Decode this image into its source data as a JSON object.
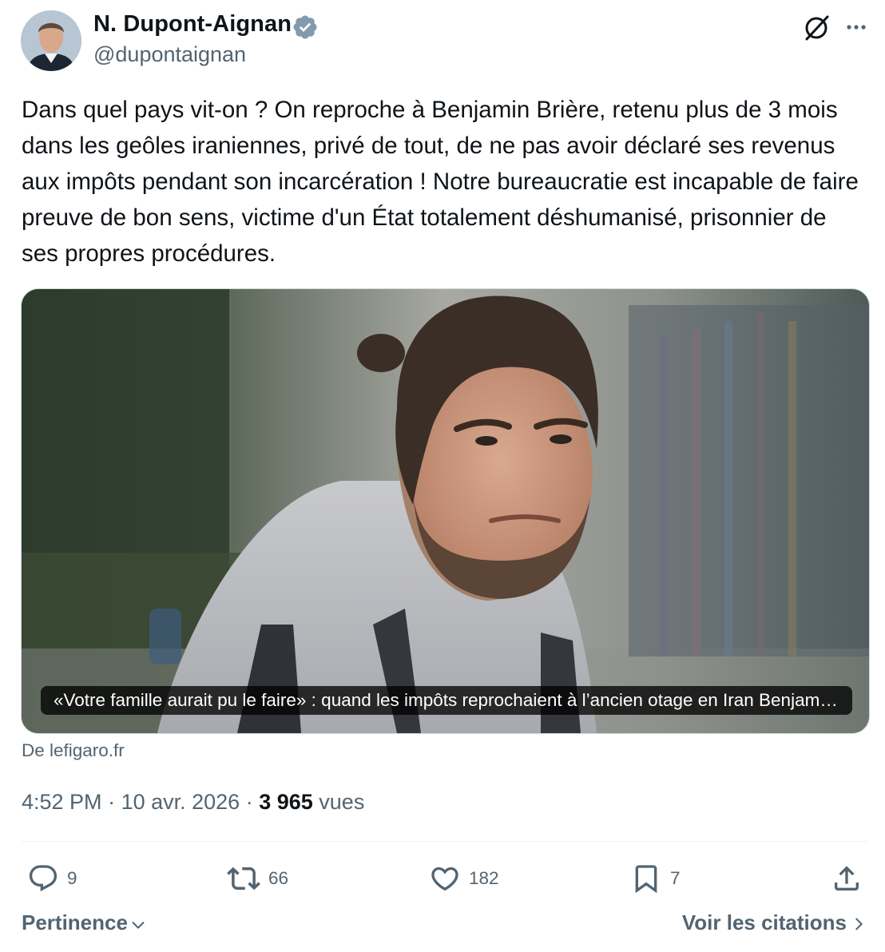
{
  "author": {
    "name": "N. Dupont-Aignan",
    "handle": "@dupontaignan",
    "verified": true,
    "verified_color": "#829aab"
  },
  "header_icons": [
    "grok-icon",
    "more-options-icon"
  ],
  "tweet": {
    "text": "Dans quel pays vit-on ? On reproche à Benjamin Brière, retenu plus de 3 mois dans les geôles iraniennes, privé de tout, de ne pas avoir déclaré ses revenus aux impôts pendant son incarcération ! Notre bureaucratie est incapable de faire preuve de bon sens, victime d'un État totalement déshumanisé, prisonnier de ses propres procédures."
  },
  "card": {
    "caption": "«Votre famille aurait pu le faire» : quand les impôts reprochaient à l’ancien otage en Iran Benjamin Brière",
    "source": "De lefigaro.fr"
  },
  "meta": {
    "time": "4:52 PM",
    "separator": " · ",
    "date": "10 avr. 2026",
    "views_count": "3 965",
    "views_label": "vues"
  },
  "actions": {
    "replies": "9",
    "reposts": "66",
    "likes": "182",
    "bookmarks": "7"
  },
  "footer": {
    "sort_label": "Pertinence",
    "quotes_label": "Voir les citations"
  },
  "colors": {
    "text_primary": "#0f1419",
    "text_secondary": "#536471",
    "border": "#cfd9de"
  }
}
